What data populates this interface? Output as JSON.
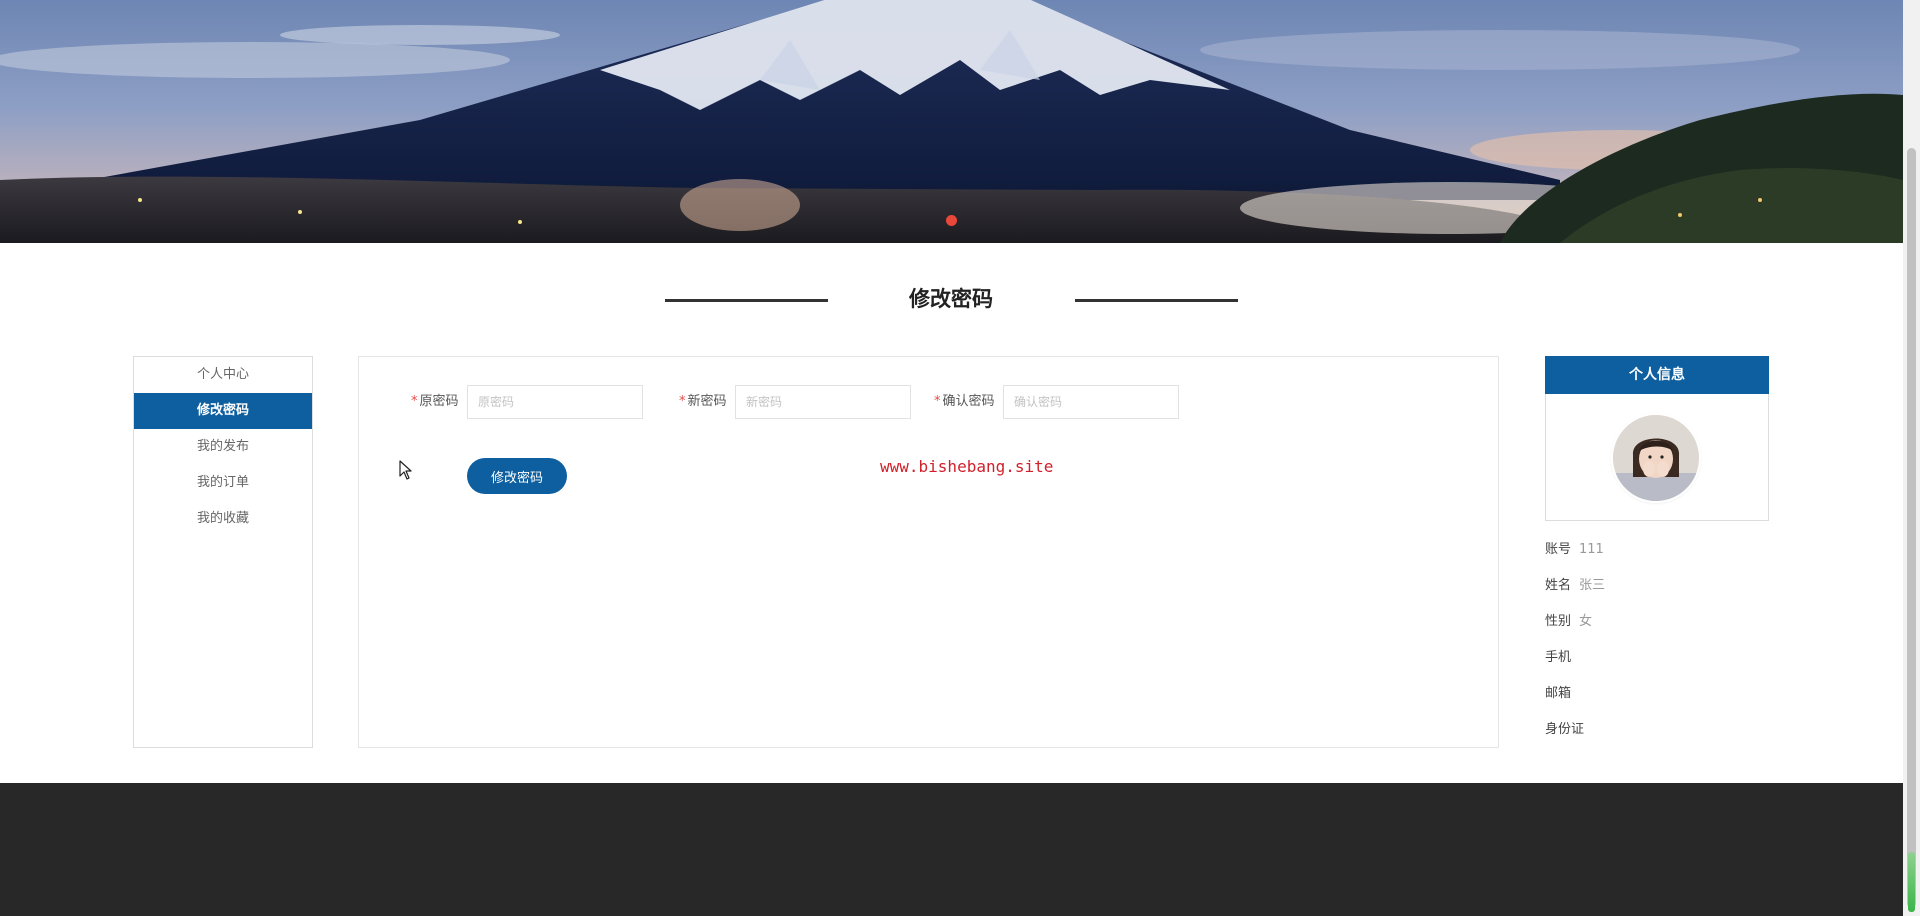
{
  "banner": {
    "active_slide": 1
  },
  "page_title": "修改密码",
  "side_menu": {
    "items": [
      {
        "label": "个人中心",
        "active": false
      },
      {
        "label": "修改密码",
        "active": true
      },
      {
        "label": "我的发布",
        "active": false
      },
      {
        "label": "我的订单",
        "active": false
      },
      {
        "label": "我的收藏",
        "active": false
      }
    ]
  },
  "form": {
    "old_password": {
      "label": "原密码",
      "placeholder": "原密码",
      "value": ""
    },
    "new_password": {
      "label": "新密码",
      "placeholder": "新密码",
      "value": ""
    },
    "confirm_password": {
      "label": "确认密码",
      "placeholder": "确认密码",
      "value": ""
    },
    "required_mark": "*",
    "submit_label": "修改密码"
  },
  "watermark": "www.bishebang.site",
  "profile": {
    "header": "个人信息",
    "fields": [
      {
        "label": "账号",
        "value": "111"
      },
      {
        "label": "姓名",
        "value": "张三"
      },
      {
        "label": "性别",
        "value": "女"
      },
      {
        "label": "手机",
        "value": ""
      },
      {
        "label": "邮箱",
        "value": ""
      },
      {
        "label": "身份证",
        "value": ""
      }
    ]
  },
  "colors": {
    "primary": "#0d5fa0",
    "footer": "#282828",
    "slide_dot": "#e8473a",
    "watermark": "#d0212b"
  },
  "icons": {
    "cursor": "mouse-pointer-icon"
  }
}
